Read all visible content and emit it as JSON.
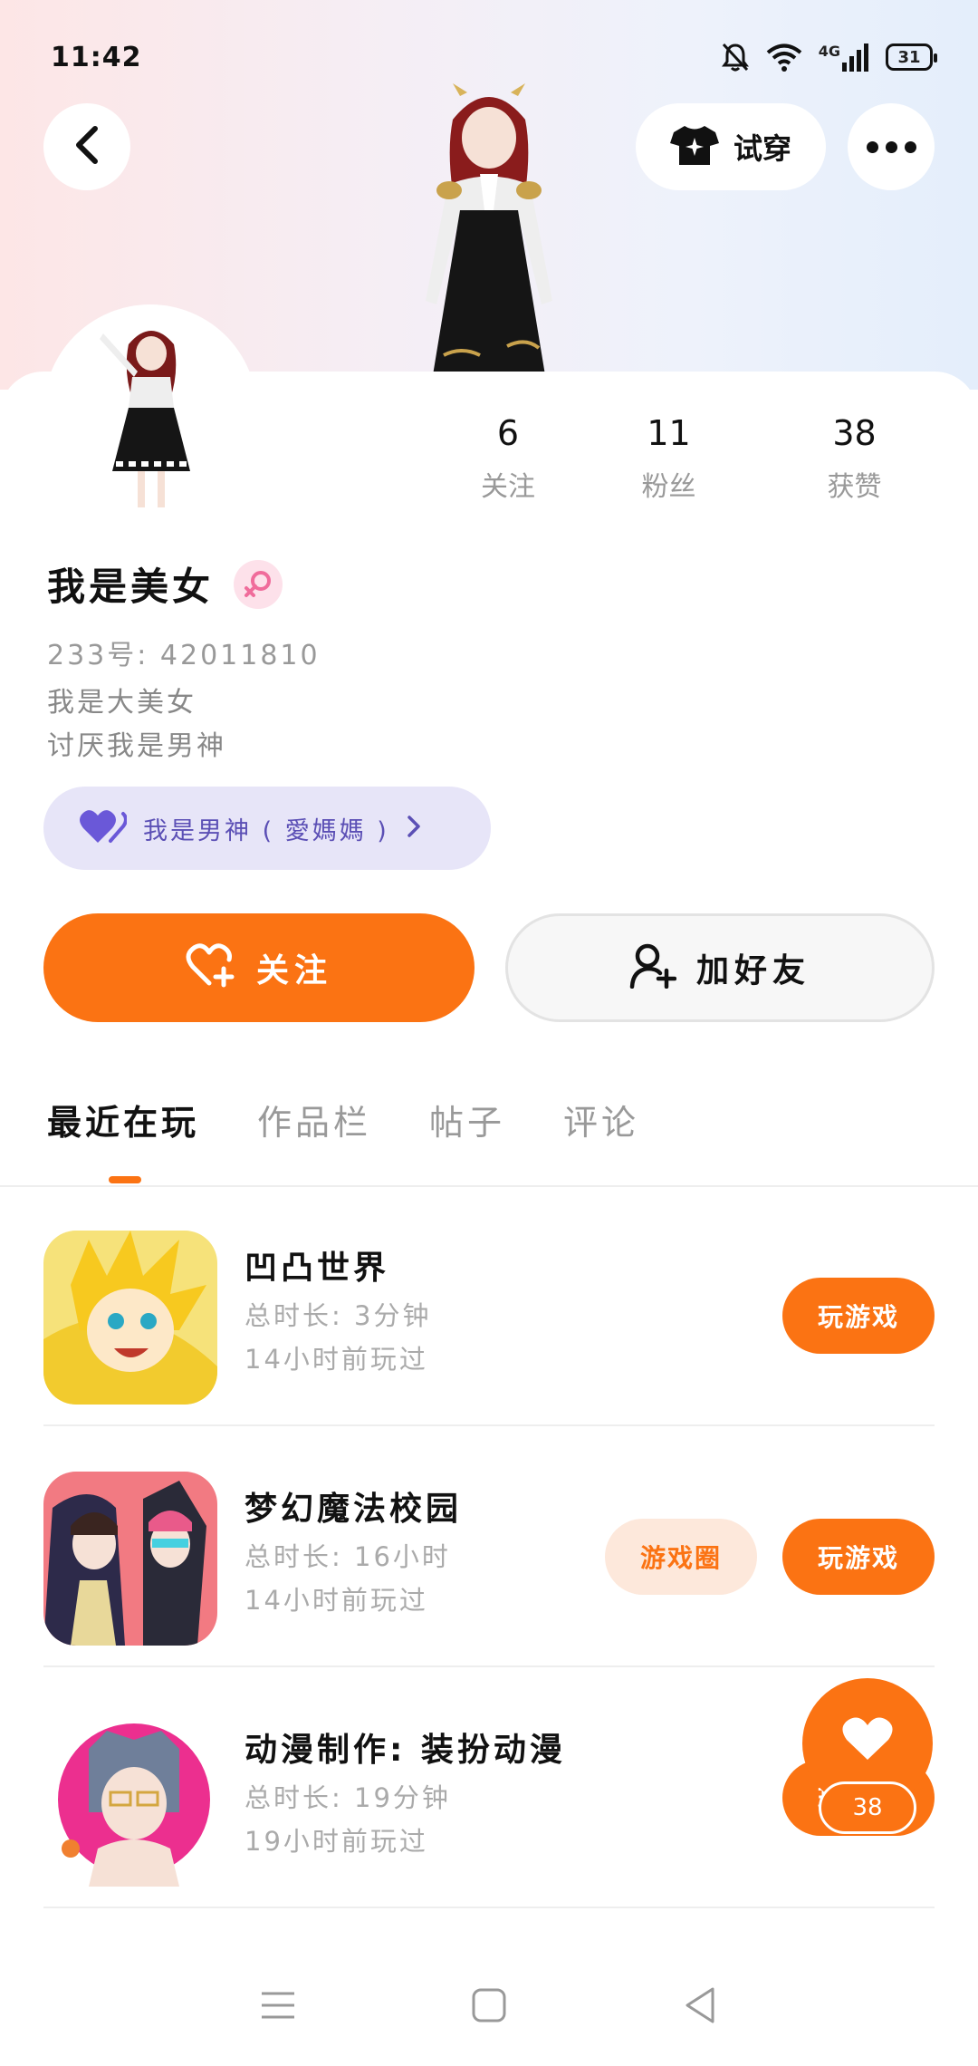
{
  "status_bar": {
    "time": "11:42",
    "network": "4G",
    "battery": "31"
  },
  "header": {
    "try_on_label": "试穿"
  },
  "profile": {
    "stats": [
      {
        "value": "6",
        "label": "关注"
      },
      {
        "value": "11",
        "label": "粉丝"
      },
      {
        "value": "38",
        "label": "获赞"
      }
    ],
    "username": "我是美女",
    "uid": "233号: 42011810",
    "bio_line1": "我是大美女",
    "bio_line2": "讨厌我是男神",
    "relation_text": "我是男神 ( 愛媽媽 )",
    "follow_label": "关注",
    "add_friend_label": "加好友"
  },
  "tabs": [
    {
      "label": "最近在玩"
    },
    {
      "label": "作品栏"
    },
    {
      "label": "帖子"
    },
    {
      "label": "评论"
    }
  ],
  "games": [
    {
      "title": "凹凸世界",
      "duration": "总时长: 3分钟",
      "last_played": "14小时前玩过",
      "play_label": "玩游戏"
    },
    {
      "title": "梦幻魔法校园",
      "duration": "总时长: 16小时",
      "last_played": "14小时前玩过",
      "circle_label": "游戏圈",
      "play_label": "玩游戏"
    },
    {
      "title": "动漫制作: 装扮动漫",
      "duration": "总时长: 19分钟",
      "last_played": "19小时前玩过",
      "play_label": "玩游戏"
    }
  ],
  "floating_like": {
    "count": "38"
  },
  "colors": {
    "accent": "#fb7313",
    "accent_light": "#fde8db",
    "relation_bg": "#e7e5f8",
    "relation_text": "#5b4fb5",
    "gender_bg": "#fde1ea",
    "gender_icon": "#f06c9b"
  }
}
